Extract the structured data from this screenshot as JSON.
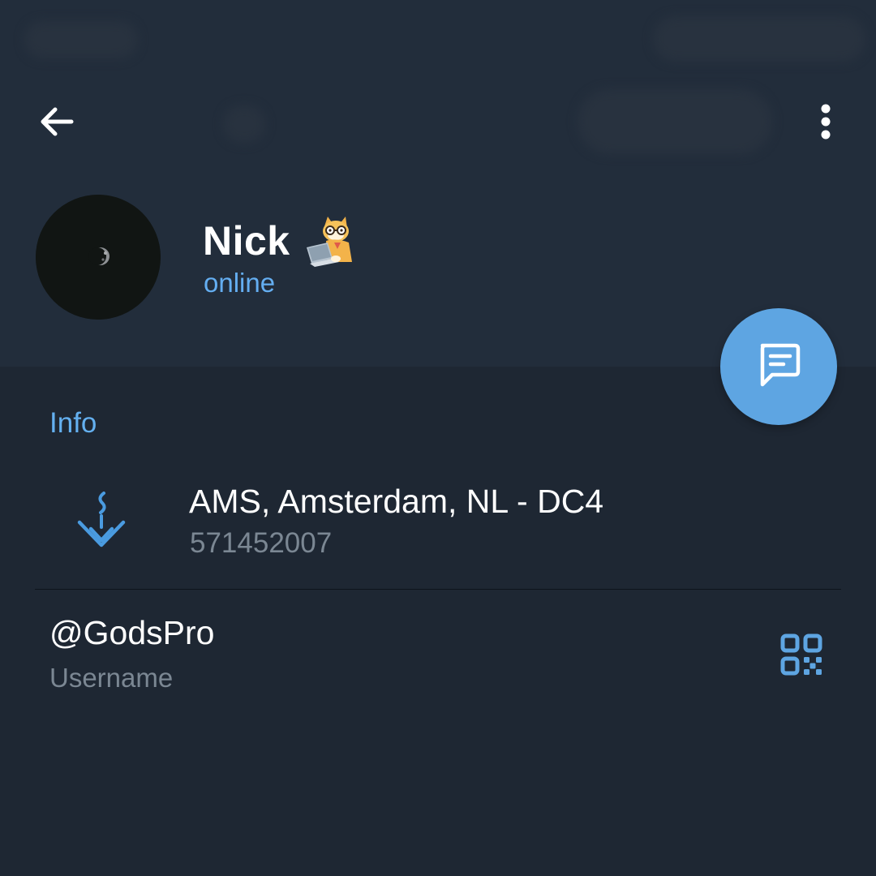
{
  "profile": {
    "name": "Nick",
    "status": "online",
    "avatar_icon": "moon-avatar",
    "emoji_status_icon": "cat-laptop-sticker-icon"
  },
  "toolbar": {
    "back_icon": "arrow-left-icon",
    "menu_icon": "more-vertical-icon"
  },
  "fab": {
    "icon": "message-icon"
  },
  "info_section": {
    "title": "Info",
    "location": {
      "icon": "location-pin-icon",
      "title": "AMS, Amsterdam, NL - DC4",
      "subtitle": "571452007"
    },
    "username": {
      "value": "@GodsPro",
      "label": "Username",
      "icon": "qr-code-icon"
    }
  },
  "colors": {
    "header_bg": "#222d3b",
    "body_bg": "#1e2733",
    "accent": "#64aef1",
    "fab": "#5ea5e2",
    "secondary_text": "#7b8793"
  }
}
